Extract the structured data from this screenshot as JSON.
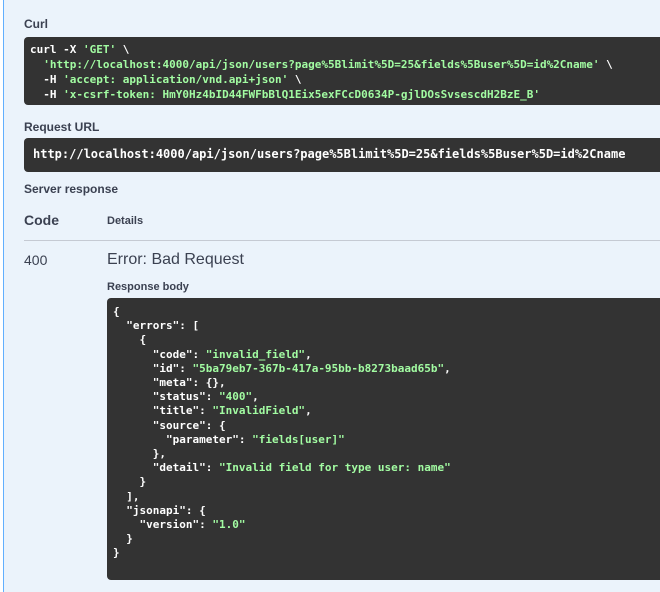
{
  "curl": {
    "label": "Curl",
    "lines": [
      [
        [
          "curl -X ",
          "p"
        ],
        [
          "'GET'",
          "s"
        ],
        [
          " \\",
          "p"
        ]
      ],
      [
        [
          "  ",
          "p"
        ],
        [
          "'http://localhost:4000/api/json/users?page%5Blimit%5D=25&fields%5Buser%5D=id%2Cname'",
          "s"
        ],
        [
          " \\",
          "p"
        ]
      ],
      [
        [
          "  -H ",
          "p"
        ],
        [
          "'accept: application/vnd.api+json'",
          "s"
        ],
        [
          " \\",
          "p"
        ]
      ],
      [
        [
          "  -H ",
          "p"
        ],
        [
          "'x-csrf-token: HmY0Hz4bID44FWFbBlQ1Eix5exFCcD0634P-gjlDOsSvsescdH2BzE_B'",
          "s"
        ]
      ]
    ]
  },
  "request_url": {
    "label": "Request URL",
    "value": "http://localhost:4000/api/json/users?page%5Blimit%5D=25&fields%5Buser%5D=id%2Cname"
  },
  "server_response": {
    "label": "Server response",
    "code_header": "Code",
    "details_header": "Details",
    "code": "400",
    "status_text": "Error: Bad Request",
    "body_label": "Response body",
    "body_lines": [
      [
        [
          "{",
          "p"
        ]
      ],
      [
        [
          "  \"errors\": [",
          "p"
        ]
      ],
      [
        [
          "    {",
          "p"
        ]
      ],
      [
        [
          "      \"code\": ",
          "p"
        ],
        [
          "\"invalid_field\"",
          "s"
        ],
        [
          ",",
          "p"
        ]
      ],
      [
        [
          "      \"id\": ",
          "p"
        ],
        [
          "\"5ba79eb7-367b-417a-95bb-b8273baad65b\"",
          "s"
        ],
        [
          ",",
          "p"
        ]
      ],
      [
        [
          "      \"meta\": {},",
          "p"
        ]
      ],
      [
        [
          "      \"status\": ",
          "p"
        ],
        [
          "\"400\"",
          "s"
        ],
        [
          ",",
          "p"
        ]
      ],
      [
        [
          "      \"title\": ",
          "p"
        ],
        [
          "\"InvalidField\"",
          "s"
        ],
        [
          ",",
          "p"
        ]
      ],
      [
        [
          "      \"source\": {",
          "p"
        ]
      ],
      [
        [
          "        \"parameter\": ",
          "p"
        ],
        [
          "\"fields[user]\"",
          "s"
        ]
      ],
      [
        [
          "      },",
          "p"
        ]
      ],
      [
        [
          "      \"detail\": ",
          "p"
        ],
        [
          "\"Invalid field for type user: name\"",
          "s"
        ]
      ],
      [
        [
          "    }",
          "p"
        ]
      ],
      [
        [
          "  ],",
          "p"
        ]
      ],
      [
        [
          "  \"jsonapi\": {",
          "p"
        ]
      ],
      [
        [
          "    \"version\": ",
          "p"
        ],
        [
          "\"1.0\"",
          "s"
        ]
      ],
      [
        [
          "  }",
          "p"
        ]
      ],
      [
        [
          "}",
          "p"
        ]
      ]
    ]
  },
  "colors": {
    "code_bg": "#333333",
    "string": "#a2fca2",
    "accent": "#61affe"
  }
}
